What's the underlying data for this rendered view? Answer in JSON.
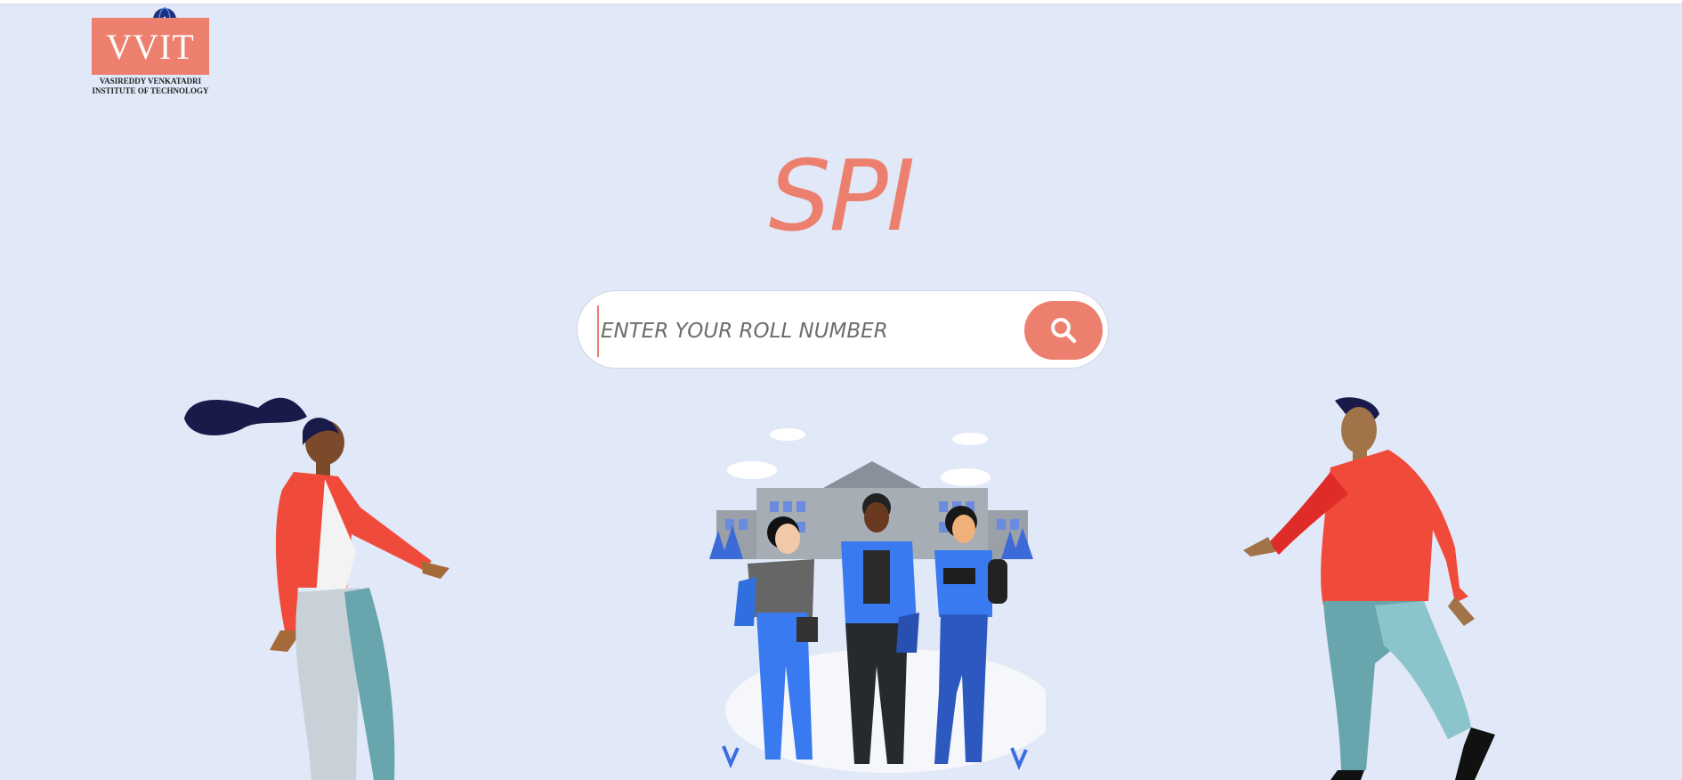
{
  "logo": {
    "mark": "VVIT",
    "line1": "Vasireddy Venkatadri",
    "line2": "Institute of Technology"
  },
  "title": "SPI",
  "search": {
    "placeholder": "ENTER YOUR ROLL NUMBER",
    "button_icon": "search-icon"
  },
  "colors": {
    "background": "#e1e8f7",
    "accent": "#ec7f6d"
  }
}
